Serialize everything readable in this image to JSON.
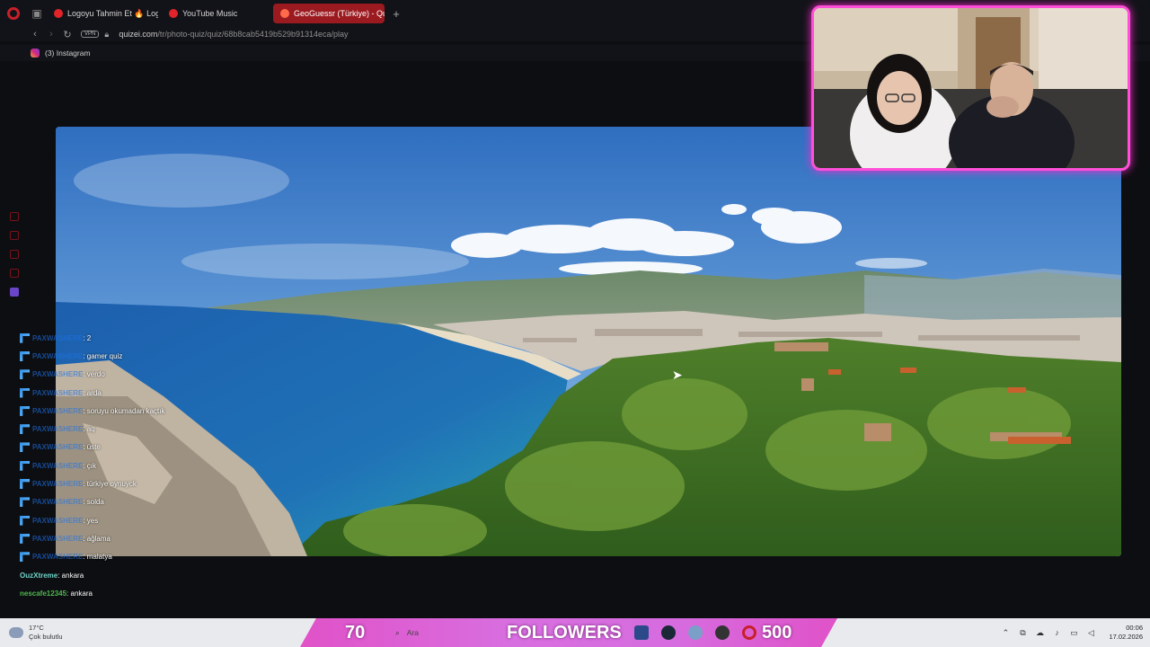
{
  "browser": {
    "tabs": [
      {
        "label": "Logoyu Tahmin Et 🔥 Log",
        "favicon_color": "#e0242a",
        "active": false
      },
      {
        "label": "YouTube Music",
        "favicon_color": "#e0242a",
        "active": false
      },
      {
        "label": "GeoGuessr (Türkiye) - Qui",
        "favicon_color": "#e0242a",
        "active": true
      }
    ],
    "new_tab": "+",
    "vpn_label": "VPN",
    "url_host": "quizei.com",
    "url_path": "/tr/photo-quiz/quiz/68b8cab5419b529b91314eca/play",
    "bookmark": "(3) Instagram"
  },
  "chat": {
    "messages": [
      {
        "user": "PAXWASHERE",
        "text": ": 2"
      },
      {
        "user": "PAXWASHERE",
        "text": ": gamer quiz"
      },
      {
        "user": "PAXWASHERE",
        "text": ": verdo"
      },
      {
        "user": "PAXWASHERE",
        "text": ": arda"
      },
      {
        "user": "PAXWASHERE",
        "text": ": soruyu okumadan kaçtık"
      },
      {
        "user": "PAXWASHERE",
        "text": ": aq"
      },
      {
        "user": "PAXWASHERE",
        "text": ": üste"
      },
      {
        "user": "PAXWASHERE",
        "text": ": çık"
      },
      {
        "user": "PAXWASHERE",
        "text": ": türkiye oynuyck"
      },
      {
        "user": "PAXWASHERE",
        "text": ": solda"
      },
      {
        "user": "PAXWASHERE",
        "text": ": yes"
      },
      {
        "user": "PAXWASHERE",
        "text": ": ağlama"
      },
      {
        "user": "PAXWASHERE",
        "text": ": malatya"
      }
    ],
    "plain_messages": [
      {
        "user": "OuzXtreme",
        "text": ": ankara"
      },
      {
        "user": "nescafe12345",
        "text": ": ankara"
      }
    ]
  },
  "overlay": {
    "left_count": "70",
    "label": "FOLLOWERS",
    "right_count": "500"
  },
  "taskbar": {
    "weather_temp": "17°C",
    "weather_desc": "Çok bulutlu",
    "search_placeholder": "Ara",
    "time": "00:06",
    "date": "17.02.2026"
  }
}
